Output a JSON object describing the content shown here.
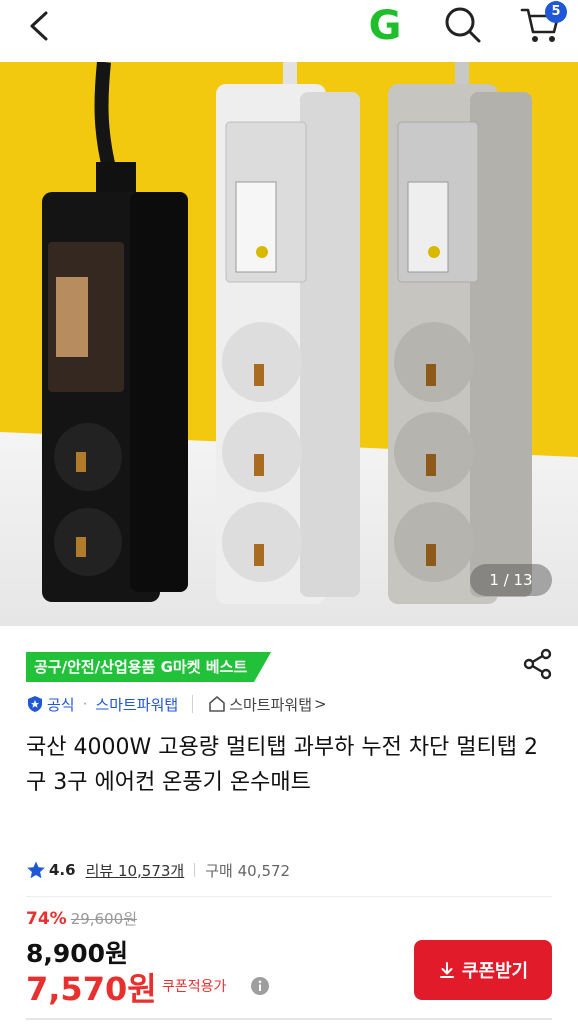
{
  "header": {
    "icons": [
      "back-arrow-icon",
      "gmarket-logo",
      "search-icon",
      "cart-icon"
    ],
    "logo_letter": "G",
    "cart_count": "5"
  },
  "gallery": {
    "counter": "1 / 13"
  },
  "badge": {
    "category_rank": "공구/안전/산업용품 G마켓 베스트"
  },
  "brand": {
    "official_label": "공식",
    "dot": "·",
    "seller_name": "스마트파워탭",
    "store_link": "스마트파워탭",
    "chevron": ">"
  },
  "product": {
    "title": "국산 4000W 고용량 멀티탭 과부하 누전 차단 멀티탭 2구 3구 에어컨 온풍기 온수매트"
  },
  "rating": {
    "score": "4.6",
    "reviews": "리뷰 10,573개",
    "purchases": "구매 40,572"
  },
  "price": {
    "discount_rate": "74%",
    "original": "29,600원",
    "sale": "8,900원",
    "coupon_price": "7,570원",
    "coupon_note": "쿠폰적용가"
  },
  "actions": {
    "coupon_button": "쿠폰받기"
  },
  "colors": {
    "brand_green": "#21c23a",
    "accent_blue": "#1f57d6",
    "sale_red": "#e8312f",
    "button_red": "#e21b2a",
    "hero_yellow": "#f2c90f"
  }
}
